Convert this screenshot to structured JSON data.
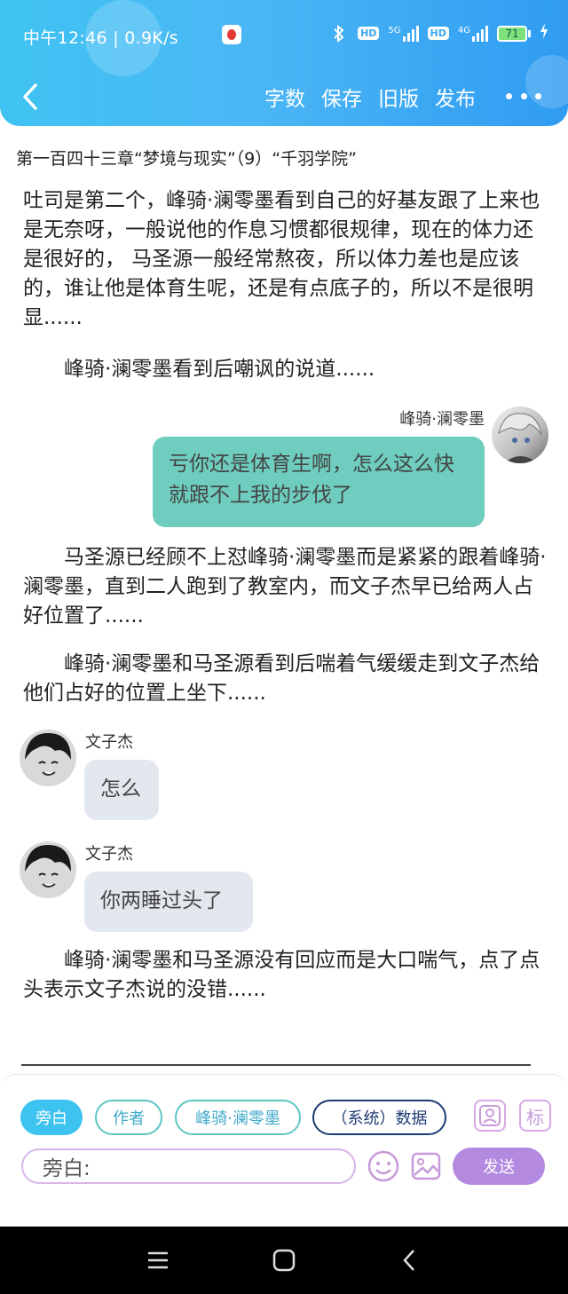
{
  "status_bar": {
    "time_speed": "中午12:46 | 0.9K/s",
    "battery": "71",
    "net1": "5G",
    "net2": "4G",
    "hd": "HD"
  },
  "header": {
    "actions": [
      "字数",
      "保存",
      "旧版",
      "发布"
    ]
  },
  "chapter_title": "第一百四十三章“梦境与现实”（9）“千羽学院”",
  "paragraphs": {
    "p1": "吐司是第二个，峰骑·澜零墨看到自己的好基友跟了上来也是无奈呀，一般说他的作息习惯都很规律，现在的体力还是很好的， 马圣源一般经常熬夜，所以体力差也是应该的，谁让他是体育生呢，还是有点底子的，所以不是很明显......",
    "p2": "峰骑·澜零墨看到后嘲讽的说道......",
    "p3": "马圣源已经顾不上怼峰骑·澜零墨而是紧紧的跟着峰骑·澜零墨，直到二人跑到了教室内，而文子杰早已给两人占好位置了......",
    "p4": "峰骑·澜零墨和马圣源看到后喘着气缓缓走到文子杰给他们占好的位置上坐下......",
    "p5": "峰骑·澜零墨和马圣源没有回应而是大口喘气，点了点头表示文子杰说的没错......"
  },
  "messages": {
    "m1": {
      "sender": "峰骑·澜零墨",
      "text": "亏你还是体育生啊，怎么这么快就跟不上我的步伐了"
    },
    "m2": {
      "sender": "文子杰",
      "text": "怎么"
    },
    "m3": {
      "sender": "文子杰",
      "text": "你两睡过头了"
    }
  },
  "composer": {
    "chips": [
      "旁白",
      "作者",
      "峰骑·澜零墨",
      "（系统）数据"
    ],
    "tag_button": "标",
    "input_value": "旁白:",
    "send_label": "发送"
  },
  "colors": {
    "header_start": "#3fc3f2",
    "header_end": "#2f9cf2",
    "right_bubble": "#6ecdbe",
    "left_bubble": "#e3e8ef",
    "send_button": "#b38ae0"
  }
}
